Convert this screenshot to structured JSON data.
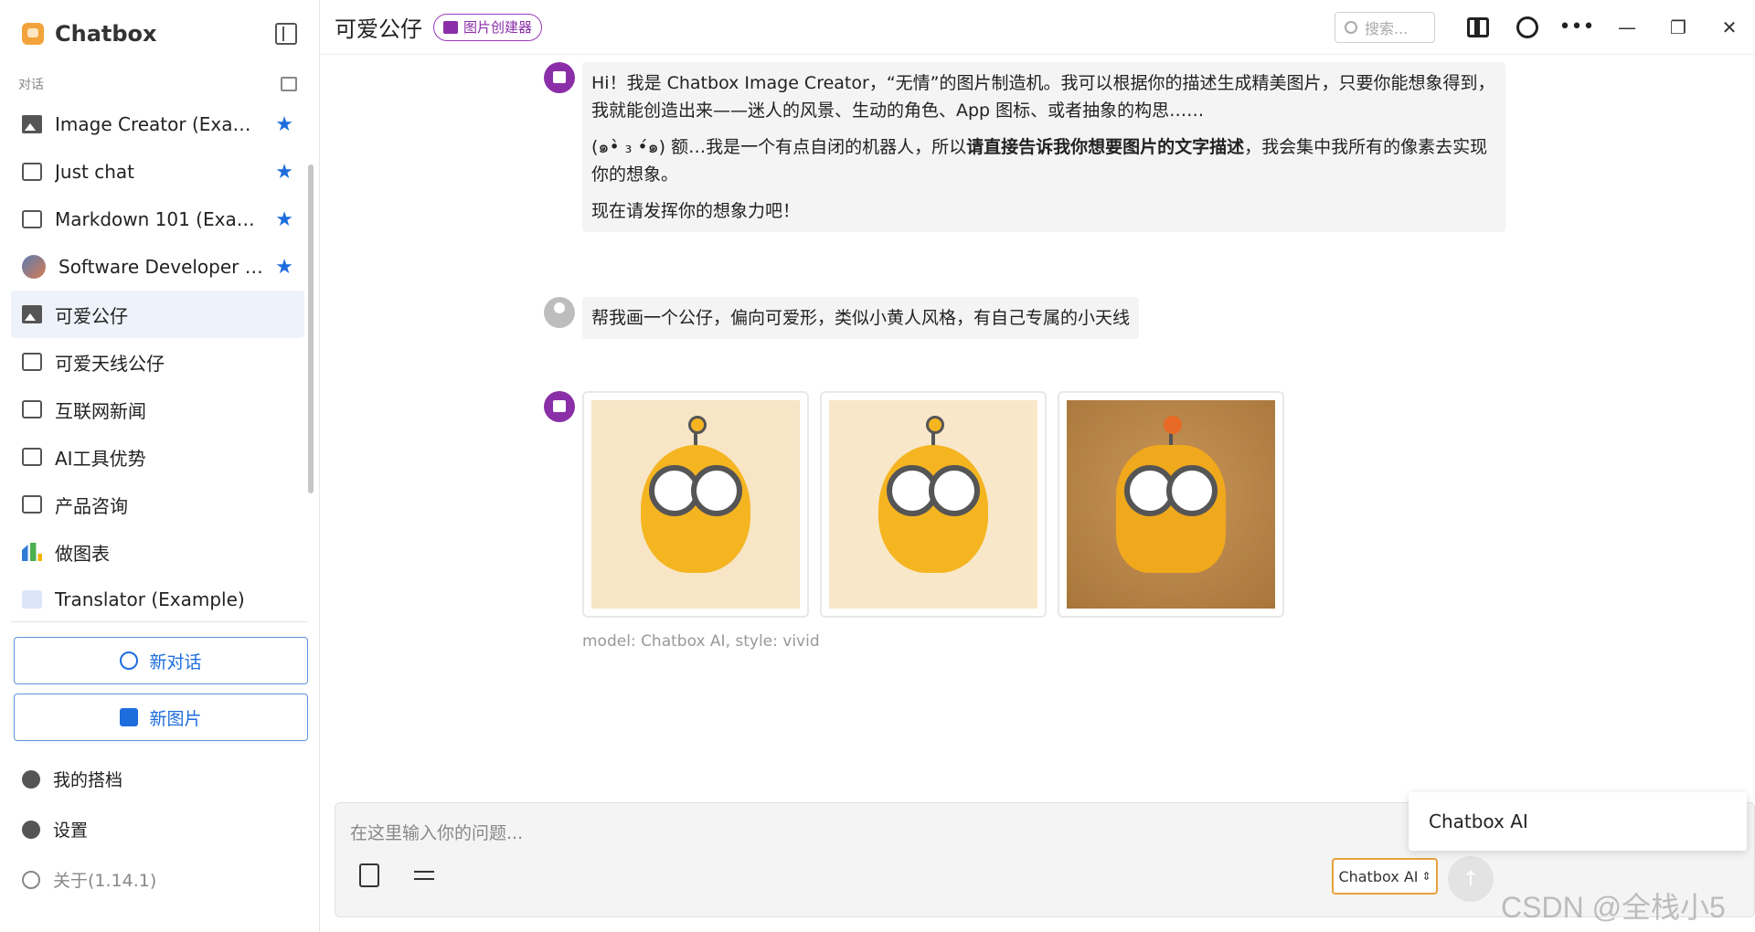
{
  "sidebar": {
    "app_title": "Chatbox",
    "section_label": "对话",
    "sessions": [
      {
        "label": "Image Creator (Example)",
        "icon": "image-icon",
        "starred": true
      },
      {
        "label": "Just chat",
        "icon": "chat-icon",
        "starred": true
      },
      {
        "label": "Markdown 101 (Exampl...",
        "icon": "chat-icon",
        "starred": true
      },
      {
        "label": "Software Developer (Ex...",
        "icon": "avatar-icon",
        "starred": true
      },
      {
        "label": "可爱公仔",
        "icon": "image-icon",
        "starred": false,
        "active": true
      },
      {
        "label": "可爱天线公仔",
        "icon": "chat-icon",
        "starred": false
      },
      {
        "label": "互联网新闻",
        "icon": "chat-icon",
        "starred": false
      },
      {
        "label": "AI工具优势",
        "icon": "chat-icon",
        "starred": false
      },
      {
        "label": "产品咨询",
        "icon": "chat-icon",
        "starred": false
      },
      {
        "label": "做图表",
        "icon": "chart-icon",
        "starred": false
      },
      {
        "label": "Translator (Example)",
        "icon": "translate-icon",
        "starred": false
      }
    ],
    "new_chat_label": "新对话",
    "new_image_label": "新图片",
    "my_copilots_label": "我的搭档",
    "settings_label": "设置",
    "about_label": "关于(1.14.1)"
  },
  "header": {
    "title": "可爱公仔",
    "badge": "图片创建器",
    "search_placeholder": "搜索..."
  },
  "messages": {
    "assistant_intro_p1": "Hi！我是 Chatbox Image Creator，“无情”的图片制造机。我可以根据你的描述生成精美图片，只要你能想象得到，我就能创造出来——迷人的风景、生动的角色、App 图标、或者抽象的构思……",
    "assistant_intro_p2_pre": "(๑•̀ ₃ •́๑) 额…我是一个有点自闭的机器人，所以",
    "assistant_intro_p2_bold": "请直接告诉我你想要图片的文字描述",
    "assistant_intro_p2_post": "，我会集中我所有的像素去实现你的想象。",
    "assistant_intro_p3": "现在请发挥你的想象力吧！",
    "user_text": "帮我画一个公仔，偏向可爱形，类似小黄人风格，有自己专属的小天线",
    "image_caption": "model: Chatbox AI, style: vivid"
  },
  "input": {
    "placeholder": "在这里输入你的问题...",
    "model_selected": "Chatbox AI",
    "dropdown_option": "Chatbox AI"
  },
  "watermark": "CSDN @全栈小5",
  "colors": {
    "accent": "#1e6ddc",
    "badge": "#8a2fa8",
    "model_border": "#e6a23c"
  }
}
